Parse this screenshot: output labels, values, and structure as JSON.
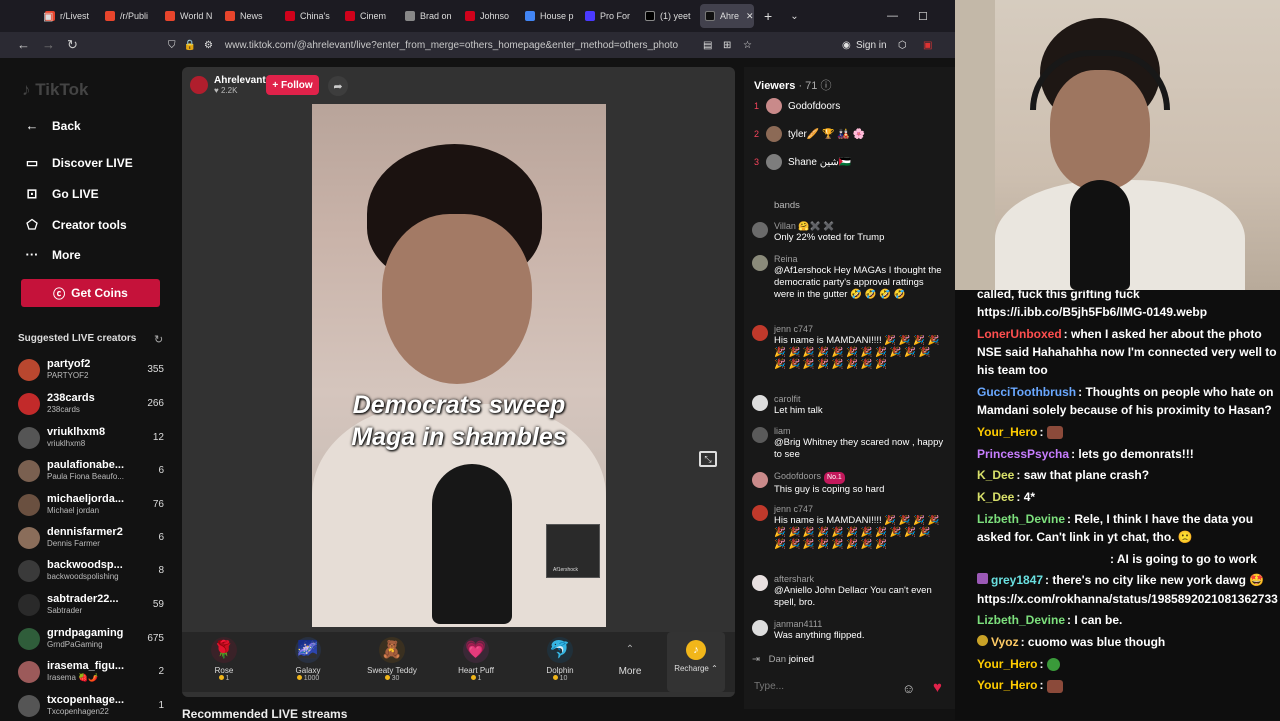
{
  "browser": {
    "tabs": [
      {
        "label": "r/Livest",
        "color": "#e8452c"
      },
      {
        "label": "/r/Publi",
        "color": "#e8452c"
      },
      {
        "label": "World N",
        "color": "#e8452c"
      },
      {
        "label": "News",
        "color": "#e8452c"
      },
      {
        "label": "China's",
        "color": "#d0021b"
      },
      {
        "label": "Cinem",
        "color": "#d0021b"
      },
      {
        "label": "Brad on",
        "color": "#888888"
      },
      {
        "label": "Johnso",
        "color": "#d0021b"
      },
      {
        "label": "House p",
        "color": "#4285f4"
      },
      {
        "label": "Pro For",
        "color": "#4a3aff"
      },
      {
        "label": "(1) yeet",
        "color": "#000000"
      },
      {
        "label": "Ahre",
        "color": "#111111"
      }
    ],
    "url": "www.tiktok.com/@ahrelevant/live?enter_from_merge=others_homepage&enter_method=others_photo",
    "sign_in": "Sign in"
  },
  "sidebar": {
    "logo": "TikTok",
    "nav": [
      {
        "label": "Back",
        "icon": "←"
      },
      {
        "label": "Discover LIVE",
        "icon": "▭"
      },
      {
        "label": "Go LIVE",
        "icon": "⊡"
      },
      {
        "label": "Creator tools",
        "icon": "⬠"
      },
      {
        "label": "More",
        "icon": "···"
      }
    ],
    "coins_button": "Get Coins",
    "suggested_title": "Suggested LIVE creators",
    "creators": [
      {
        "name": "partyof2",
        "sub": "PARTYOF2",
        "count": "355",
        "color": "#b9472f"
      },
      {
        "name": "238cards",
        "sub": "238cards",
        "count": "266",
        "color": "#c22a2a"
      },
      {
        "name": "vriuklhxm8",
        "sub": "vriuklhxm8",
        "count": "12",
        "color": "#555555"
      },
      {
        "name": "paulafionabe...",
        "sub": "Paula Fiona Beaufo...",
        "count": "6",
        "color": "#7a6050"
      },
      {
        "name": "michaeljorda...",
        "sub": "Michael jordan",
        "count": "76",
        "color": "#6a5040"
      },
      {
        "name": "dennisfarmer2",
        "sub": "Dennis Farmer",
        "count": "6",
        "color": "#8a6d5a"
      },
      {
        "name": "backwoodsp...",
        "sub": "backwoodspolishing",
        "count": "8",
        "color": "#3a3a3a"
      },
      {
        "name": "sabtrader22...",
        "sub": "Sabtrader",
        "count": "59",
        "color": "#2a2a2a"
      },
      {
        "name": "grndpagaming",
        "sub": "GrndPaGaming",
        "count": "675",
        "color": "#2f5d3a"
      },
      {
        "name": "irasema_figu...",
        "sub": "Irasema 🍓🌶️",
        "count": "2",
        "color": "#9c5a5a"
      },
      {
        "name": "txcopenhage...",
        "sub": "Txcopenhagen22",
        "count": "1",
        "color": "#555555"
      }
    ]
  },
  "player": {
    "host_name": "Ahrelevant",
    "host_likes": "♥ 2.2K",
    "follow_label": "+ Follow",
    "caption_line1": "Democrats sweep",
    "caption_line2": "Maga in shambles",
    "pip_label": "Af1ershock",
    "gifts": [
      {
        "name": "Rose",
        "price": "1",
        "icon": "🌹",
        "bg": "#3a2228"
      },
      {
        "name": "Galaxy",
        "price": "1000",
        "icon": "🌌",
        "bg": "#283040"
      },
      {
        "name": "Sweaty Teddy",
        "price": "30",
        "icon": "🧸",
        "bg": "#3a3020"
      },
      {
        "name": "Heart Puff",
        "price": "1",
        "icon": "💗",
        "bg": "#3a2836"
      },
      {
        "name": "Dolphin",
        "price": "10",
        "icon": "🐬",
        "bg": "#20303a"
      }
    ],
    "more_label": "More",
    "recharge_label": "Recharge ⌃",
    "recommended": "Recommended LIVE streams"
  },
  "viewers": {
    "title": "Viewers",
    "count": "· 71",
    "top": [
      {
        "rank": "1",
        "name": "Godofdoors",
        "color": "#c98a8a"
      },
      {
        "rank": "2",
        "name": "tyler🥖 🏆 🎎 🌸",
        "color": "#8c6a56"
      },
      {
        "rank": "3",
        "name": "Shane شين🇵🇸",
        "color": "#7d7d7d"
      }
    ],
    "messages": [
      {
        "user": "",
        "text": "bands",
        "color": "#181818",
        "badge": ""
      },
      {
        "user": "Villan 🤗✖️ ✖️",
        "text": "Only 22% voted for Trump",
        "color": "#6a6a6a",
        "badge": ""
      },
      {
        "user": "Reina",
        "text": "@Af1ershock Hey MAGAs I thought the democratic party's approval rattings were in the gutter 🤣 🤣 🤣 🤣",
        "color": "#8a8a7a",
        "badge": ""
      },
      {
        "user": "jenn c747",
        "text": "His name is MAMDANI!!!! 🎉 🎉 🎉 🎉 🎉 🎉 🎉 🎉 🎉 🎉 🎉 🎉 🎉 🎉 🎉 🎉 🎉 🎉 🎉 🎉 🎉 🎉 🎉",
        "color": "#c0392b",
        "badge": ""
      },
      {
        "user": "carolfit",
        "text": "Let him talk",
        "color": "#dddddd",
        "badge": ""
      },
      {
        "user": "liam",
        "text": "@Brig Whitney they scared now , happy to see",
        "color": "#5a5a5a",
        "badge": ""
      },
      {
        "user": "Godofdoors",
        "text": "This guy is coping so hard",
        "color": "#c98a8a",
        "badge": "No.1"
      },
      {
        "user": "jenn c747",
        "text": "His name is MAMDANI!!!! 🎉 🎉 🎉 🎉 🎉 🎉 🎉 🎉 🎉 🎉 🎉 🎉 🎉 🎉 🎉 🎉 🎉 🎉 🎉 🎉 🎉 🎉 🎉",
        "color": "#c0392b",
        "badge": ""
      },
      {
        "user": "aftershark",
        "text": "@Aniello John Dellacr You can't even spell, bro.",
        "color": "#e8e0e0",
        "badge": ""
      },
      {
        "user": "janman4111",
        "text": "Was anything flipped.",
        "color": "#dddddd",
        "badge": ""
      }
    ],
    "join_user": "Dan",
    "join_text": "joined",
    "type_placeholder": "Type..."
  },
  "ytchat": {
    "lines": [
      {
        "user": "",
        "color": "#ffffff",
        "text": "called, fuck this grifting fuck https://i.ibb.co/B5jh5Fb6/IMG-0149.webp",
        "emote": ""
      },
      {
        "user": "LonerUnboxed",
        "color": "#ff4f4f",
        "text": ": when I asked her about the photo NSE said Hahahahha now I'm connected very well to his team too",
        "emote": ""
      },
      {
        "user": "GucciToothbrush",
        "color": "#6aa8ff",
        "text": ": Thoughts on people who hate on Mamdani solely because of his proximity to Hasan?",
        "emote": ""
      },
      {
        "user": "Your_Hero",
        "color": "#ffcc00",
        "text": ":",
        "emote": "#8b4a3a"
      },
      {
        "user": "PrincessPsycha",
        "color": "#c77dff",
        "text": ": lets go demonrats!!!",
        "emote": ""
      },
      {
        "user": "K_Dee",
        "color": "#d8e06a",
        "text": ": saw that plane crash?",
        "emote": ""
      },
      {
        "user": "K_Dee",
        "color": "#d8e06a",
        "text": ": 4*",
        "emote": ""
      },
      {
        "user": "Lizbeth_Devine",
        "color": "#7de07d",
        "text": ": Rele, I think I have the data you asked for. Can't link in yt chat, tho. 🙁",
        "emote": ""
      },
      {
        "user": "",
        "color": "#ffffff",
        "text": ": AI is going to go to work",
        "emote": ""
      },
      {
        "user": "grey1847",
        "color": "#6ae0e0",
        "text": ": there's no city like new york dawg 🤩 https://x.com/rokhanna/status/1985892021081362733",
        "emote": ""
      },
      {
        "user": "Lizbeth_Devine",
        "color": "#7de07d",
        "text": ": I can be.",
        "emote": ""
      },
      {
        "user": "Vyoz",
        "color": "#ffcc66",
        "text": ": cuomo was blue though",
        "emote": ""
      },
      {
        "user": "Your_Hero",
        "color": "#ffcc00",
        "text": ":",
        "emote": "#3a9a3a"
      },
      {
        "user": "Your_Hero",
        "color": "#ffcc00",
        "text": ":",
        "emote": "#8b4a3a"
      }
    ]
  }
}
